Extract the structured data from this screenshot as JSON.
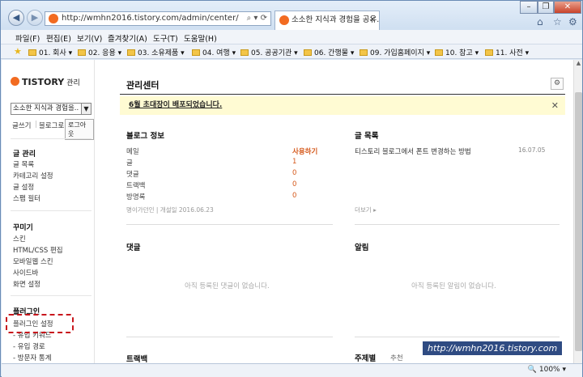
{
  "browser": {
    "url": "http://wmhn2016.tistory.com/admin/center/",
    "tab_title": "소소한 지식과 경험을 공유...",
    "zoom": "100%"
  },
  "menu": [
    "파일(F)",
    "편집(E)",
    "보기(V)",
    "즐겨찾기(A)",
    "도구(T)",
    "도움말(H)"
  ],
  "favorites": [
    "01. 회사",
    "02. 응용",
    "03. 소유제품",
    "04. 여행",
    "05. 공공기관",
    "06. 간행물",
    "09. 가입홈페이지",
    "10. 참고",
    "11. 사전"
  ],
  "sidebar": {
    "brand": "TISTORY",
    "brand_sub": "관리",
    "blog_select": "소소한 지식과 경험을..",
    "write": "글쓰기",
    "blog_home": "블로그로",
    "logout": "로그아웃",
    "sections": [
      {
        "title": "글 관리",
        "items": [
          "글 목록",
          "카테고리 설정",
          "글 설정",
          "스팸 필터"
        ]
      },
      {
        "title": "꾸미기",
        "items": [
          "스킨",
          "HTML/CSS 편집",
          "모바일웹 스킨",
          "사이드바",
          "화면 설정"
        ]
      },
      {
        "title": "플러그인",
        "items": [
          "플러그인 설정",
          "- 유입 키워드",
          "- 유입 경로",
          "- 방문자 통계"
        ]
      }
    ]
  },
  "main": {
    "title": "관리센터",
    "notice": "6월 초대장이 배포되었습니다.",
    "blog_info": {
      "title": "블로그 정보",
      "rows": [
        {
          "label": "메일",
          "value": "사용하기"
        },
        {
          "label": "글",
          "value": "1"
        },
        {
          "label": "댓글",
          "value": "0"
        },
        {
          "label": "트랙백",
          "value": "0"
        },
        {
          "label": "방명록",
          "value": "0"
        }
      ],
      "footer": "명이가던인 | 개설일 2016.06.23"
    },
    "posts": {
      "title": "글 목록",
      "items": [
        {
          "title": "티스토리 블로그에서 폰트 변경하는 방법",
          "date": "16.07.05"
        }
      ],
      "more": "더보기 ▸"
    },
    "comments": {
      "title": "댓글",
      "empty": "아직 등록된 댓글이 없습니다."
    },
    "alerts": {
      "title": "알림",
      "empty": "아직 등록된 알림이 없습니다."
    },
    "trackback": {
      "title": "트랙백"
    },
    "themes": {
      "title": "주제별",
      "first_tab": "추천"
    }
  },
  "watermark": "http://wmhn2016.tistory.com"
}
